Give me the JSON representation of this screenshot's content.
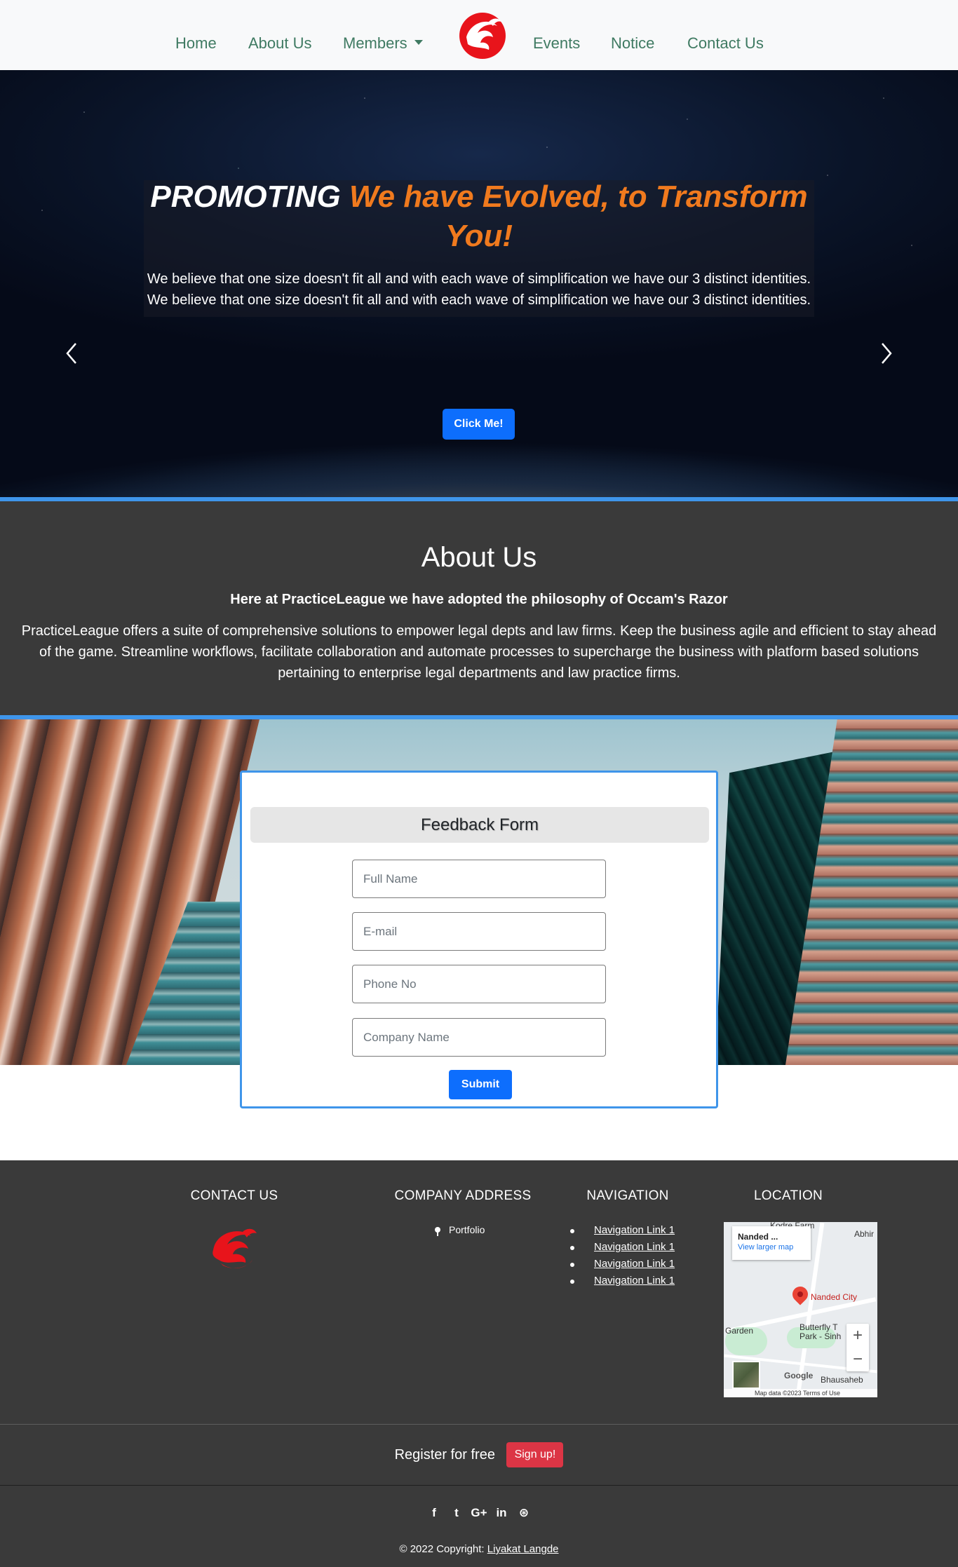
{
  "nav": {
    "items": [
      {
        "label": "Home"
      },
      {
        "label": "About Us"
      },
      {
        "label": "Members"
      },
      {
        "label": "Events"
      },
      {
        "label": "Notice"
      },
      {
        "label": "Contact Us"
      }
    ],
    "logo_icon": "phoenix-logo-icon"
  },
  "hero": {
    "title_white": "PROMOTING",
    "title_orange": "We have Evolved, to Transform You!",
    "subtitle_line1": "We believe that one size doesn't fit all and with each wave of simplification we have our 3 distinct identities.",
    "subtitle_line2": "We believe that one size doesn't fit all and with each wave of simplification we have our 3 distinct identities.",
    "button_label": "Click Me!",
    "accent_orange": "#f07a1e"
  },
  "about": {
    "title": "About Us",
    "lead": "Here at PracticeLeague we have adopted the philosophy of Occam's Razor",
    "text": "PracticeLeague offers a suite of comprehensive solutions to empower legal depts and law firms. Keep the business agile and efficient to stay ahead of the game. Streamline workflows, facilitate collaboration and automate processes to supercharge the business with platform based solutions pertaining to enterprise legal departments and law practice firms."
  },
  "feedback": {
    "title": "Feedback Form",
    "fields": [
      {
        "placeholder": "Full Name"
      },
      {
        "placeholder": "E-mail"
      },
      {
        "placeholder": "Phone No"
      },
      {
        "placeholder": "Company Name"
      }
    ],
    "submit_label": "Submit"
  },
  "footer": {
    "contact_heading": "CONTACT US",
    "address_heading": "COMPANY ADDRESS",
    "address_item": "Portfolio",
    "nav_heading": "NAVIGATION",
    "nav_links": [
      "Navigation Link 1",
      "Navigation Link 1",
      "Navigation Link 1",
      "Navigation Link 1"
    ],
    "location_heading": "LOCATION",
    "map": {
      "info_title": "Nanded ...",
      "info_link": "View larger map",
      "marker_label": "Nanded City",
      "labels": [
        "Kodre Farm",
        "Abhir",
        "Butterfly T",
        "Park - Sinh",
        "Garden",
        "Bhausaheb",
        "Google"
      ],
      "zoom_in": "+",
      "zoom_out": "−",
      "footer_text": "Map data ©2023   Terms of Use"
    },
    "register_text": "Register for free",
    "signup_label": "Sign up!",
    "social_icons": [
      "facebook-icon",
      "twitter-icon",
      "google-plus-icon",
      "linkedin-icon",
      "dribbble-icon"
    ],
    "social_glyphs": [
      "f",
      "t",
      "G+",
      "in",
      "⊛"
    ],
    "copyright_prefix": "© 2022 Copyright: ",
    "copyright_name": "Liyakat Langde"
  },
  "colors": {
    "nav_text": "#3f7a62",
    "primary": "#0d6efd",
    "accent_bar": "#3f95ea",
    "dark_bg": "#3a3a3a",
    "danger": "#dc3545"
  }
}
